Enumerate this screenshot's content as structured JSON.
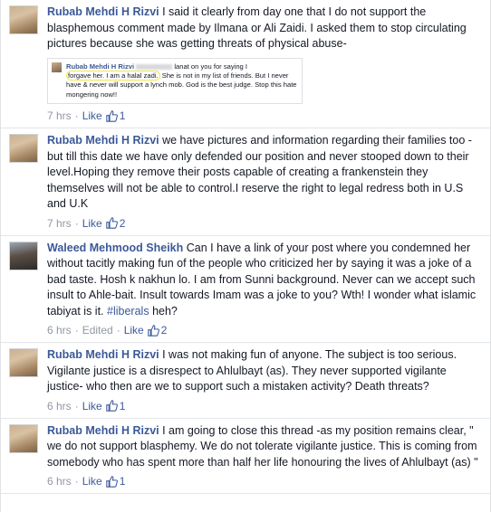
{
  "comments": [
    {
      "author": "Rubab Mehdi H Rizvi",
      "text": "I said it clearly from day one that I do not support the blasphemous comment made by Ilmana or Ali Zaidi. I asked them to stop circulating pictures because she was getting threats of physical abuse-",
      "embedded_screenshot": {
        "author": "Rubab Mehdi H Rizvi",
        "text_before": "lanat on you for saying I",
        "highlight": "forgave her. I am a halal zadi.",
        "text_after": "She is not in my list of friends. But I never have & never will support a lynch mob. God is the best judge. Stop this hate mongering now!!"
      },
      "time": "7 hrs",
      "edited": "",
      "like_label": "Like",
      "likes": "1"
    },
    {
      "author": "Rubab Mehdi H Rizvi",
      "text": "we have pictures and information regarding their families too -but till this date we have only defended our position and never stooped down to their level.Hoping they remove their posts capable of creating a frankenstein they themselves will not be able to control.I reserve the right to legal redress both in U.S and U.K",
      "time": "7 hrs",
      "edited": "",
      "like_label": "Like",
      "likes": "2"
    },
    {
      "author": "Waleed Mehmood Sheikh",
      "text": "Can I have a link of your post where you condemned her without tacitly making fun of the people who criticized her by saying it was a joke of a bad taste. Hosh k nakhun lo. I am from Sunni background. Never can we accept such insult to Ahle-bait. Insult towards Imam was a joke to you? Wth! I wonder what islamic tabiyat is it.",
      "hashtag": "#liberals",
      "text_end": "heh?",
      "time": "6 hrs",
      "edited": "Edited",
      "like_label": "Like",
      "likes": "2"
    },
    {
      "author": "Rubab Mehdi H Rizvi",
      "text": "I was not making fun of anyone. The subject is too serious. Vigilante justice is a disrespect to Ahlulbayt (as). They never supported vigilante justice- who then are we to support such a mistaken activity? Death threats?",
      "time": "6 hrs",
      "edited": "",
      "like_label": "Like",
      "likes": "1"
    },
    {
      "author": "Rubab Mehdi H Rizvi",
      "text": "I am going to close this thread -as my position remains clear, \" we do not support blasphemy. We do not tolerate vigilante justice. This is coming from somebody who has spent more than half her life honouring the lives of Ahlulbayt (as) \"",
      "time": "6 hrs",
      "edited": "",
      "like_label": "Like",
      "likes": "1"
    }
  ],
  "icons": {
    "thumb": "thumbs-up-icon"
  },
  "colors": {
    "link": "#3b5998",
    "meta": "#9197a3",
    "text": "#141823",
    "highlight": "#f2e54a"
  }
}
